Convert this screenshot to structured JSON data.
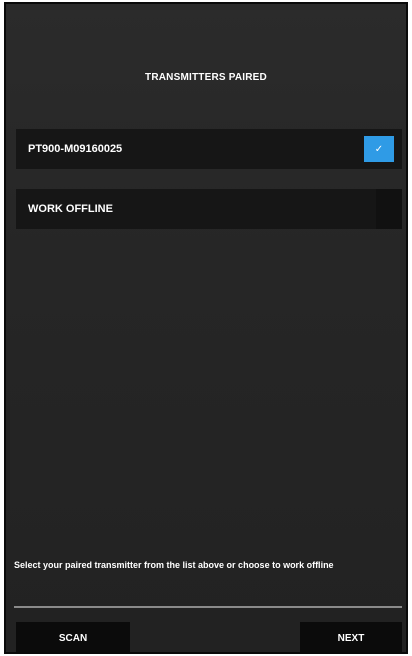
{
  "header": {
    "title": "TRANSMITTERS PAIRED"
  },
  "list": {
    "items": [
      {
        "label": "PT900-M09160025",
        "selected": true,
        "check_icon": "checkmark-icon"
      },
      {
        "label": "WORK OFFLINE",
        "selected": false
      }
    ]
  },
  "helper": {
    "text": "Select your paired transmitter from the list above or choose to work offline"
  },
  "footer": {
    "scan_label": "SCAN",
    "next_label": "NEXT"
  },
  "colors": {
    "accent": "#2f9be6",
    "background": "#262626",
    "row": "#161616"
  }
}
